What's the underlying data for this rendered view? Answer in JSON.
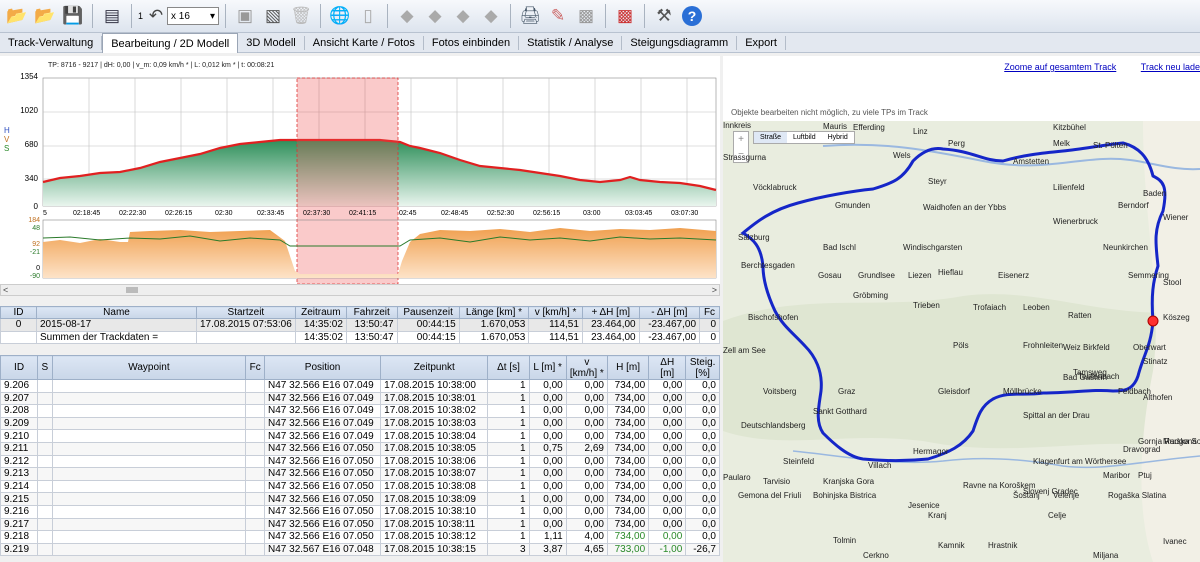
{
  "toolbar": {
    "counter": "1",
    "zoom_value": "x 16"
  },
  "menu": [
    "Track-Verwaltung",
    "Bearbeitung / 2D Modell",
    "3D Modell",
    "Ansicht Karte / Fotos",
    "Fotos einbinden",
    "Statistik / Analyse",
    "Steigungsdiagramm",
    "Export"
  ],
  "chart": {
    "info": "TP: 8716 - 9217 | dH: 0,00  | v_m: 0,09 km/h * | L: 0,012 km * | t: 00:08:21",
    "side_labels": [
      "H",
      "V",
      "S"
    ],
    "y_ticks": [
      "1354",
      "1020",
      "680",
      "340",
      "0"
    ],
    "x_ticks": [
      "5",
      "02:18:45",
      "02:22:30",
      "02:26:15",
      "02:30",
      "02:33:45",
      "02:37:30",
      "02:41:15",
      "02:45",
      "02:48:45",
      "02:52:30",
      "02:56:15",
      "03:00",
      "03:03:45",
      "03:07:30"
    ],
    "lower_ticks": [
      "184",
      "48",
      "92",
      "-21",
      "0",
      "-90"
    ]
  },
  "track_table": {
    "headers": [
      "ID",
      "Name",
      "Startzeit",
      "Zeitraum",
      "Fahrzeit",
      "Pausenzeit",
      "Länge [km] *",
      "v [km/h] *",
      "+ ΔH [m]",
      "- ΔH [m]",
      "Fc"
    ],
    "rows": [
      [
        "0",
        "2015-08-17",
        "17.08.2015 07:53:06",
        "14:35:02",
        "13:50:47",
        "00:44:15",
        "1.670,053",
        "114,51",
        "23.464,00",
        "-23.467,00",
        "0"
      ],
      [
        "",
        "Summen der Trackdaten =",
        "",
        "14:35:02",
        "13:50:47",
        "00:44:15",
        "1.670,053",
        "114,51",
        "23.464,00",
        "-23.467,00",
        "0"
      ]
    ]
  },
  "wp_table": {
    "headers": [
      "ID",
      "S",
      "Waypoint",
      "Fc",
      "Position",
      "Zeitpunkt",
      "Δt [s]",
      "L [m] *",
      "v [km/h] *",
      "H [m]",
      "ΔH [m]",
      "Steig. [%]"
    ],
    "rows": [
      [
        "9.206",
        "",
        "",
        "",
        "N47 32.566 E16 07.049",
        "17.08.2015 10:38:00",
        "1",
        "0,00",
        "0,00",
        "734,00",
        "0,00",
        "0,0"
      ],
      [
        "9.207",
        "",
        "",
        "",
        "N47 32.566 E16 07.049",
        "17.08.2015 10:38:01",
        "1",
        "0,00",
        "0,00",
        "734,00",
        "0,00",
        "0,0"
      ],
      [
        "9.208",
        "",
        "",
        "",
        "N47 32.566 E16 07.049",
        "17.08.2015 10:38:02",
        "1",
        "0,00",
        "0,00",
        "734,00",
        "0,00",
        "0,0"
      ],
      [
        "9.209",
        "",
        "",
        "",
        "N47 32.566 E16 07.049",
        "17.08.2015 10:38:03",
        "1",
        "0,00",
        "0,00",
        "734,00",
        "0,00",
        "0,0"
      ],
      [
        "9.210",
        "",
        "",
        "",
        "N47 32.566 E16 07.049",
        "17.08.2015 10:38:04",
        "1",
        "0,00",
        "0,00",
        "734,00",
        "0,00",
        "0,0"
      ],
      [
        "9.211",
        "",
        "",
        "",
        "N47 32.566 E16 07.050",
        "17.08.2015 10:38:05",
        "1",
        "0,75",
        "2,69",
        "734,00",
        "0,00",
        "0,0"
      ],
      [
        "9.212",
        "",
        "",
        "",
        "N47 32.566 E16 07.050",
        "17.08.2015 10:38:06",
        "1",
        "0,00",
        "0,00",
        "734,00",
        "0,00",
        "0,0"
      ],
      [
        "9.213",
        "",
        "",
        "",
        "N47 32.566 E16 07.050",
        "17.08.2015 10:38:07",
        "1",
        "0,00",
        "0,00",
        "734,00",
        "0,00",
        "0,0"
      ],
      [
        "9.214",
        "",
        "",
        "",
        "N47 32.566 E16 07.050",
        "17.08.2015 10:38:08",
        "1",
        "0,00",
        "0,00",
        "734,00",
        "0,00",
        "0,0"
      ],
      [
        "9.215",
        "",
        "",
        "",
        "N47 32.566 E16 07.050",
        "17.08.2015 10:38:09",
        "1",
        "0,00",
        "0,00",
        "734,00",
        "0,00",
        "0,0"
      ],
      [
        "9.216",
        "",
        "",
        "",
        "N47 32.566 E16 07.050",
        "17.08.2015 10:38:10",
        "1",
        "0,00",
        "0,00",
        "734,00",
        "0,00",
        "0,0"
      ],
      [
        "9.217",
        "",
        "",
        "",
        "N47 32.566 E16 07.050",
        "17.08.2015 10:38:11",
        "1",
        "0,00",
        "0,00",
        "734,00",
        "0,00",
        "0,0"
      ],
      [
        "9.218",
        "",
        "",
        "",
        "N47 32.566 E16 07.050",
        "17.08.2015 10:38:12",
        "1",
        "1,11",
        "4,00",
        "734,00",
        "0,00",
        "0,0"
      ],
      [
        "9.219",
        "",
        "",
        "",
        "N47 32.567 E16 07.048",
        "17.08.2015 10:38:15",
        "3",
        "3,87",
        "4,65",
        "733,00",
        "-1,00",
        "-26,7"
      ]
    ]
  },
  "map": {
    "link_zoom": "Zoome auf gesamtem Track",
    "link_reload": "Track neu lade",
    "note": "Objekte bearbeiten nicht möglich, zu viele TPs im Track",
    "modes": [
      "Straße",
      "Luftbild",
      "Hybrid"
    ],
    "places": [
      "Efferding",
      "Linz",
      "Perg",
      "Melk",
      "St. Pölten",
      "Wels",
      "Amstetten",
      "Vöcklabruck",
      "Steyr",
      "Lilienfeld",
      "Baden",
      "Gmunden",
      "Waidhofen an der Ybbs",
      "Berndorf",
      "Wienerbruck",
      "Wiener",
      "Salzburg",
      "Bad Ischl",
      "Windischgarsten",
      "Neunkirchen",
      "Berchtesgaden",
      "Gosau",
      "Grundlsee",
      "Liezen",
      "Hieflau",
      "Eisenerz",
      "Semmering",
      "Stool",
      "Gröbming",
      "Trieben",
      "Trofaiach",
      "Leoben",
      "Ratten",
      "Bischofshofen",
      "Birkfeld",
      "Oberwart",
      "Köszeg",
      "Pöls",
      "Frohnleiten",
      "Weiz",
      "Stinatz",
      "Bad Gastein",
      "Tamsweg",
      "Teufenbach",
      "Voitsberg",
      "Graz",
      "Gleisdorf",
      "Möllbrücke",
      "Althofen",
      "Feldbach",
      "Sankt Gotthard",
      "Spittal an der Drau",
      "Deutschlandsberg",
      "Steinfeld",
      "Hermagor",
      "Klagenfurt am Wörthersee",
      "Villach",
      "Dravograd",
      "Gornja Radgona",
      "Murska Sobota",
      "Paularo",
      "Tarvisio",
      "Kranjska Gora",
      "Ravne na Koroškem",
      "Slovenj Gradec",
      "Maribor",
      "Ptuj",
      "Gemona del Friuli",
      "Bohinjska Bistrica",
      "Jesenice",
      "Kranj",
      "Šoštanj",
      "Velenje",
      "Rogaška Slatina",
      "Celje",
      "Kamnik",
      "Hrastnik",
      "Tolmin",
      "Miljana",
      "Ivanec",
      "Cerkno",
      "Strassgurna",
      "Kitzbühel",
      "Zell am See",
      "Mauris",
      "Innkreis"
    ]
  }
}
